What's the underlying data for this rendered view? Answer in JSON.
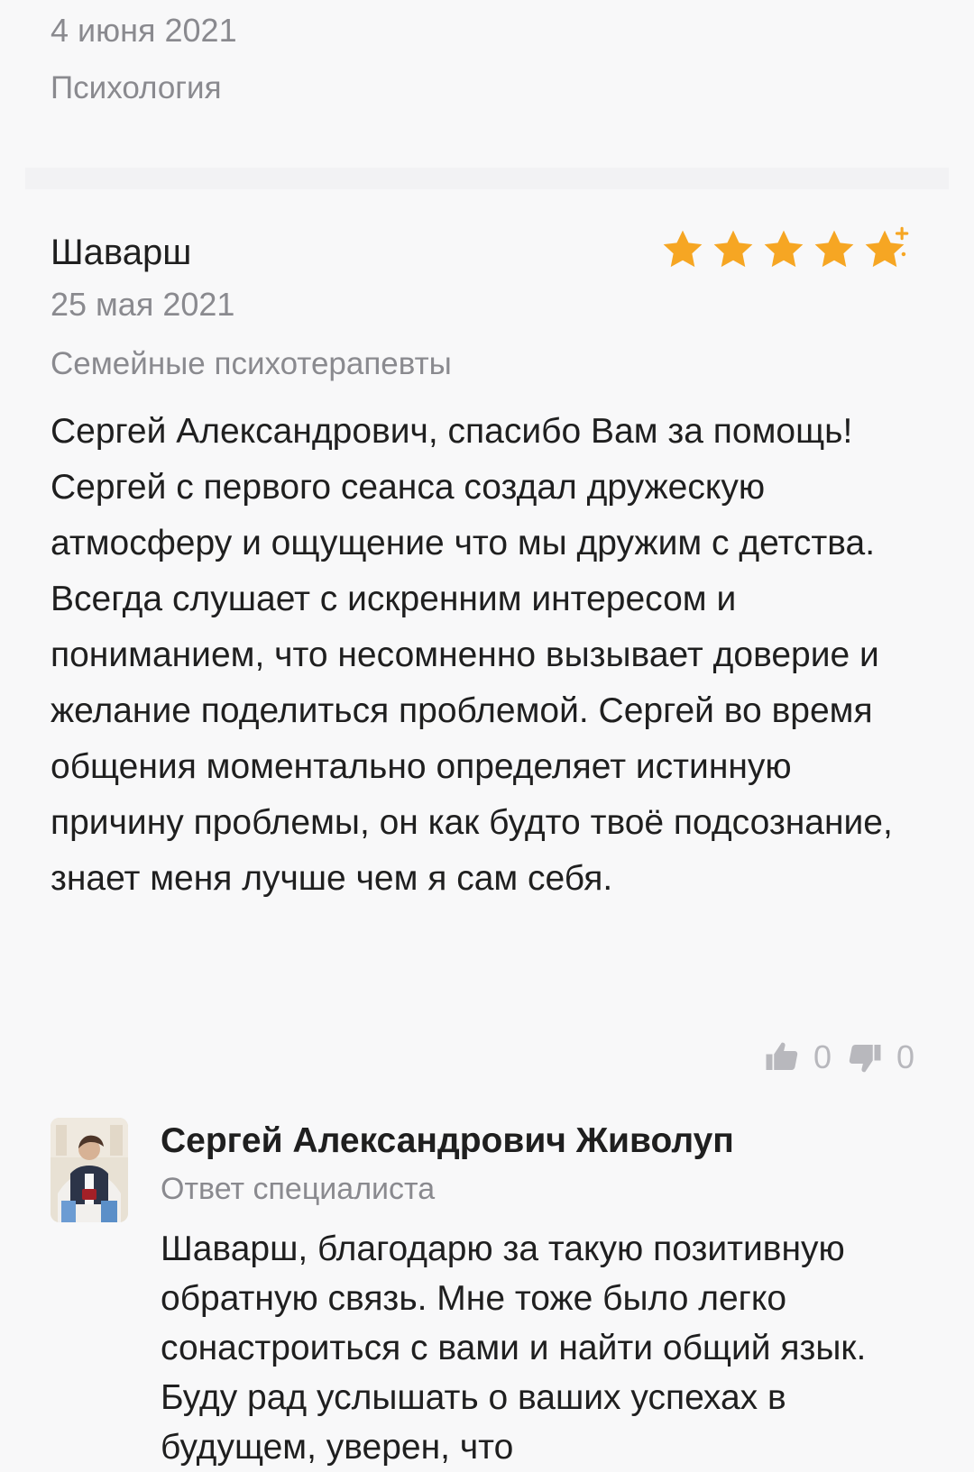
{
  "previous_review": {
    "date": "4 июня 2021",
    "category": "Психология"
  },
  "review": {
    "author": "Шаварш",
    "rating": 5,
    "date": "25 мая 2021",
    "category": "Семейные психотерапевты",
    "text": "Сергей Александрович, спасибо Вам за помощь!\nСергей с первого сеанса создал дружескую атмосферу и ощущение что мы дружим с детства. Всегда слушает с искренним интересом и пониманием, что несомненно вызывает доверие и желание поделиться проблемой. Сергей во время общения моментально определяет истинную причину проблемы, он как будто твоё подсознание, знает меня лучше чем я сам себя.",
    "likes": "0",
    "dislikes": "0"
  },
  "reply": {
    "name": "Сергей Александрович Живолуп",
    "role": "Ответ специалиста",
    "text": "Шаварш, благодарю за такую позитивную обратную связь. Мне тоже было легко сонастроиться с вами и найти общий язык. Буду рад услышать о ваших успехах в будущем, уверен, что"
  },
  "colors": {
    "background": "#f8f8f9",
    "star": "#f6a623",
    "muted": "#8a8a8f",
    "vote": "#b8b8bd"
  },
  "icons": {
    "star": "star-icon",
    "like": "thumbs-up-icon",
    "dislike": "thumbs-down-icon",
    "avatar": "avatar"
  }
}
